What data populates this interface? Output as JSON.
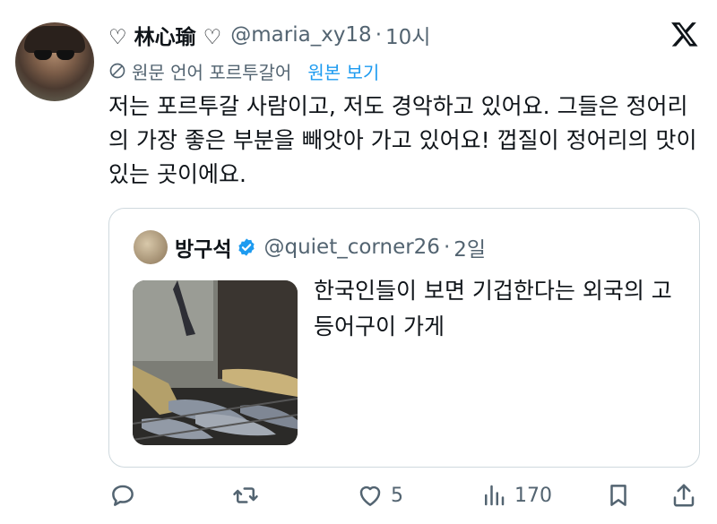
{
  "author": {
    "display_name": "♡ 林心瑜 ♡",
    "handle": "@maria_xy18",
    "separator": "·",
    "time": "10시"
  },
  "translation": {
    "label": "원문 언어 포르투갈어",
    "show_original": "원본 보기"
  },
  "tweet": {
    "text": "저는 포르투갈 사람이고, 저도 경악하고 있어요. 그들은 정어리의 가장 좋은 부분을 빼앗아 가고 있어요! 껍질이 정어리의 맛이 있는 곳이에요."
  },
  "quote": {
    "display_name": "방구석",
    "handle": "@quiet_corner26",
    "separator": "·",
    "time": "2일",
    "text": "한국인들이 보면 기겁한다는 외국의 고등어구이 가게"
  },
  "actions": {
    "replies": "",
    "retweets": "",
    "likes": "5",
    "views": "170"
  },
  "colors": {
    "accent": "#1d9bf0",
    "secondary_text": "#536471",
    "border": "#cfd9de"
  }
}
